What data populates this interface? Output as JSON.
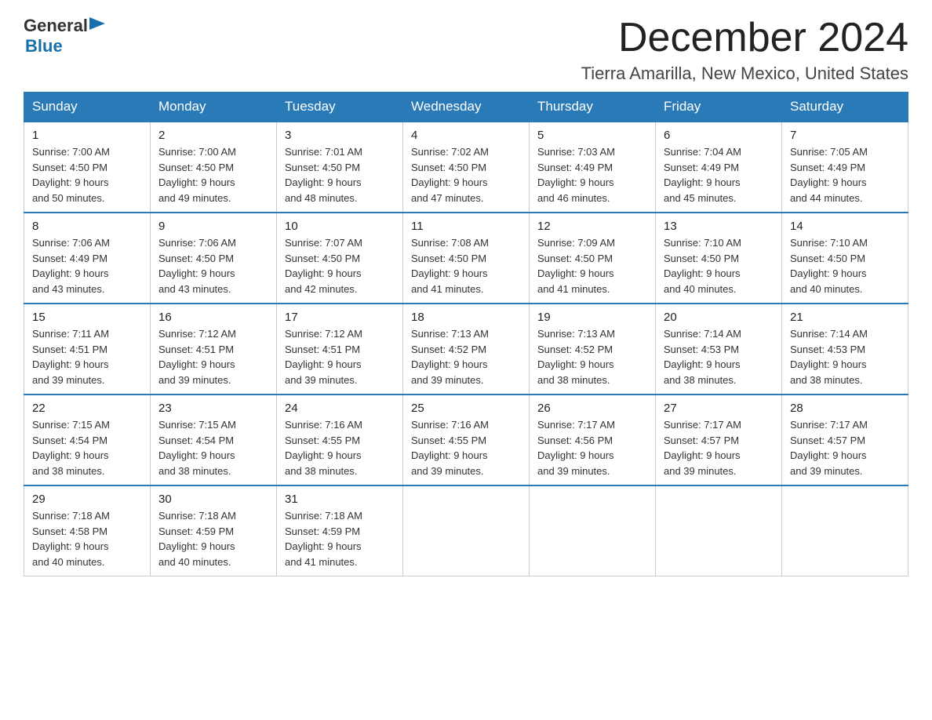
{
  "logo": {
    "general": "General",
    "blue": "Blue",
    "triangle_color": "#1a6eaa"
  },
  "header": {
    "month": "December 2024",
    "location": "Tierra Amarilla, New Mexico, United States"
  },
  "days_of_week": [
    "Sunday",
    "Monday",
    "Tuesday",
    "Wednesday",
    "Thursday",
    "Friday",
    "Saturday"
  ],
  "weeks": [
    [
      {
        "day": "1",
        "sunrise": "7:00 AM",
        "sunset": "4:50 PM",
        "daylight": "9 hours and 50 minutes."
      },
      {
        "day": "2",
        "sunrise": "7:00 AM",
        "sunset": "4:50 PM",
        "daylight": "9 hours and 49 minutes."
      },
      {
        "day": "3",
        "sunrise": "7:01 AM",
        "sunset": "4:50 PM",
        "daylight": "9 hours and 48 minutes."
      },
      {
        "day": "4",
        "sunrise": "7:02 AM",
        "sunset": "4:50 PM",
        "daylight": "9 hours and 47 minutes."
      },
      {
        "day": "5",
        "sunrise": "7:03 AM",
        "sunset": "4:49 PM",
        "daylight": "9 hours and 46 minutes."
      },
      {
        "day": "6",
        "sunrise": "7:04 AM",
        "sunset": "4:49 PM",
        "daylight": "9 hours and 45 minutes."
      },
      {
        "day": "7",
        "sunrise": "7:05 AM",
        "sunset": "4:49 PM",
        "daylight": "9 hours and 44 minutes."
      }
    ],
    [
      {
        "day": "8",
        "sunrise": "7:06 AM",
        "sunset": "4:49 PM",
        "daylight": "9 hours and 43 minutes."
      },
      {
        "day": "9",
        "sunrise": "7:06 AM",
        "sunset": "4:50 PM",
        "daylight": "9 hours and 43 minutes."
      },
      {
        "day": "10",
        "sunrise": "7:07 AM",
        "sunset": "4:50 PM",
        "daylight": "9 hours and 42 minutes."
      },
      {
        "day": "11",
        "sunrise": "7:08 AM",
        "sunset": "4:50 PM",
        "daylight": "9 hours and 41 minutes."
      },
      {
        "day": "12",
        "sunrise": "7:09 AM",
        "sunset": "4:50 PM",
        "daylight": "9 hours and 41 minutes."
      },
      {
        "day": "13",
        "sunrise": "7:10 AM",
        "sunset": "4:50 PM",
        "daylight": "9 hours and 40 minutes."
      },
      {
        "day": "14",
        "sunrise": "7:10 AM",
        "sunset": "4:50 PM",
        "daylight": "9 hours and 40 minutes."
      }
    ],
    [
      {
        "day": "15",
        "sunrise": "7:11 AM",
        "sunset": "4:51 PM",
        "daylight": "9 hours and 39 minutes."
      },
      {
        "day": "16",
        "sunrise": "7:12 AM",
        "sunset": "4:51 PM",
        "daylight": "9 hours and 39 minutes."
      },
      {
        "day": "17",
        "sunrise": "7:12 AM",
        "sunset": "4:51 PM",
        "daylight": "9 hours and 39 minutes."
      },
      {
        "day": "18",
        "sunrise": "7:13 AM",
        "sunset": "4:52 PM",
        "daylight": "9 hours and 39 minutes."
      },
      {
        "day": "19",
        "sunrise": "7:13 AM",
        "sunset": "4:52 PM",
        "daylight": "9 hours and 38 minutes."
      },
      {
        "day": "20",
        "sunrise": "7:14 AM",
        "sunset": "4:53 PM",
        "daylight": "9 hours and 38 minutes."
      },
      {
        "day": "21",
        "sunrise": "7:14 AM",
        "sunset": "4:53 PM",
        "daylight": "9 hours and 38 minutes."
      }
    ],
    [
      {
        "day": "22",
        "sunrise": "7:15 AM",
        "sunset": "4:54 PM",
        "daylight": "9 hours and 38 minutes."
      },
      {
        "day": "23",
        "sunrise": "7:15 AM",
        "sunset": "4:54 PM",
        "daylight": "9 hours and 38 minutes."
      },
      {
        "day": "24",
        "sunrise": "7:16 AM",
        "sunset": "4:55 PM",
        "daylight": "9 hours and 38 minutes."
      },
      {
        "day": "25",
        "sunrise": "7:16 AM",
        "sunset": "4:55 PM",
        "daylight": "9 hours and 39 minutes."
      },
      {
        "day": "26",
        "sunrise": "7:17 AM",
        "sunset": "4:56 PM",
        "daylight": "9 hours and 39 minutes."
      },
      {
        "day": "27",
        "sunrise": "7:17 AM",
        "sunset": "4:57 PM",
        "daylight": "9 hours and 39 minutes."
      },
      {
        "day": "28",
        "sunrise": "7:17 AM",
        "sunset": "4:57 PM",
        "daylight": "9 hours and 39 minutes."
      }
    ],
    [
      {
        "day": "29",
        "sunrise": "7:18 AM",
        "sunset": "4:58 PM",
        "daylight": "9 hours and 40 minutes."
      },
      {
        "day": "30",
        "sunrise": "7:18 AM",
        "sunset": "4:59 PM",
        "daylight": "9 hours and 40 minutes."
      },
      {
        "day": "31",
        "sunrise": "7:18 AM",
        "sunset": "4:59 PM",
        "daylight": "9 hours and 41 minutes."
      },
      null,
      null,
      null,
      null
    ]
  ],
  "labels": {
    "sunrise": "Sunrise:",
    "sunset": "Sunset:",
    "daylight": "Daylight:"
  }
}
